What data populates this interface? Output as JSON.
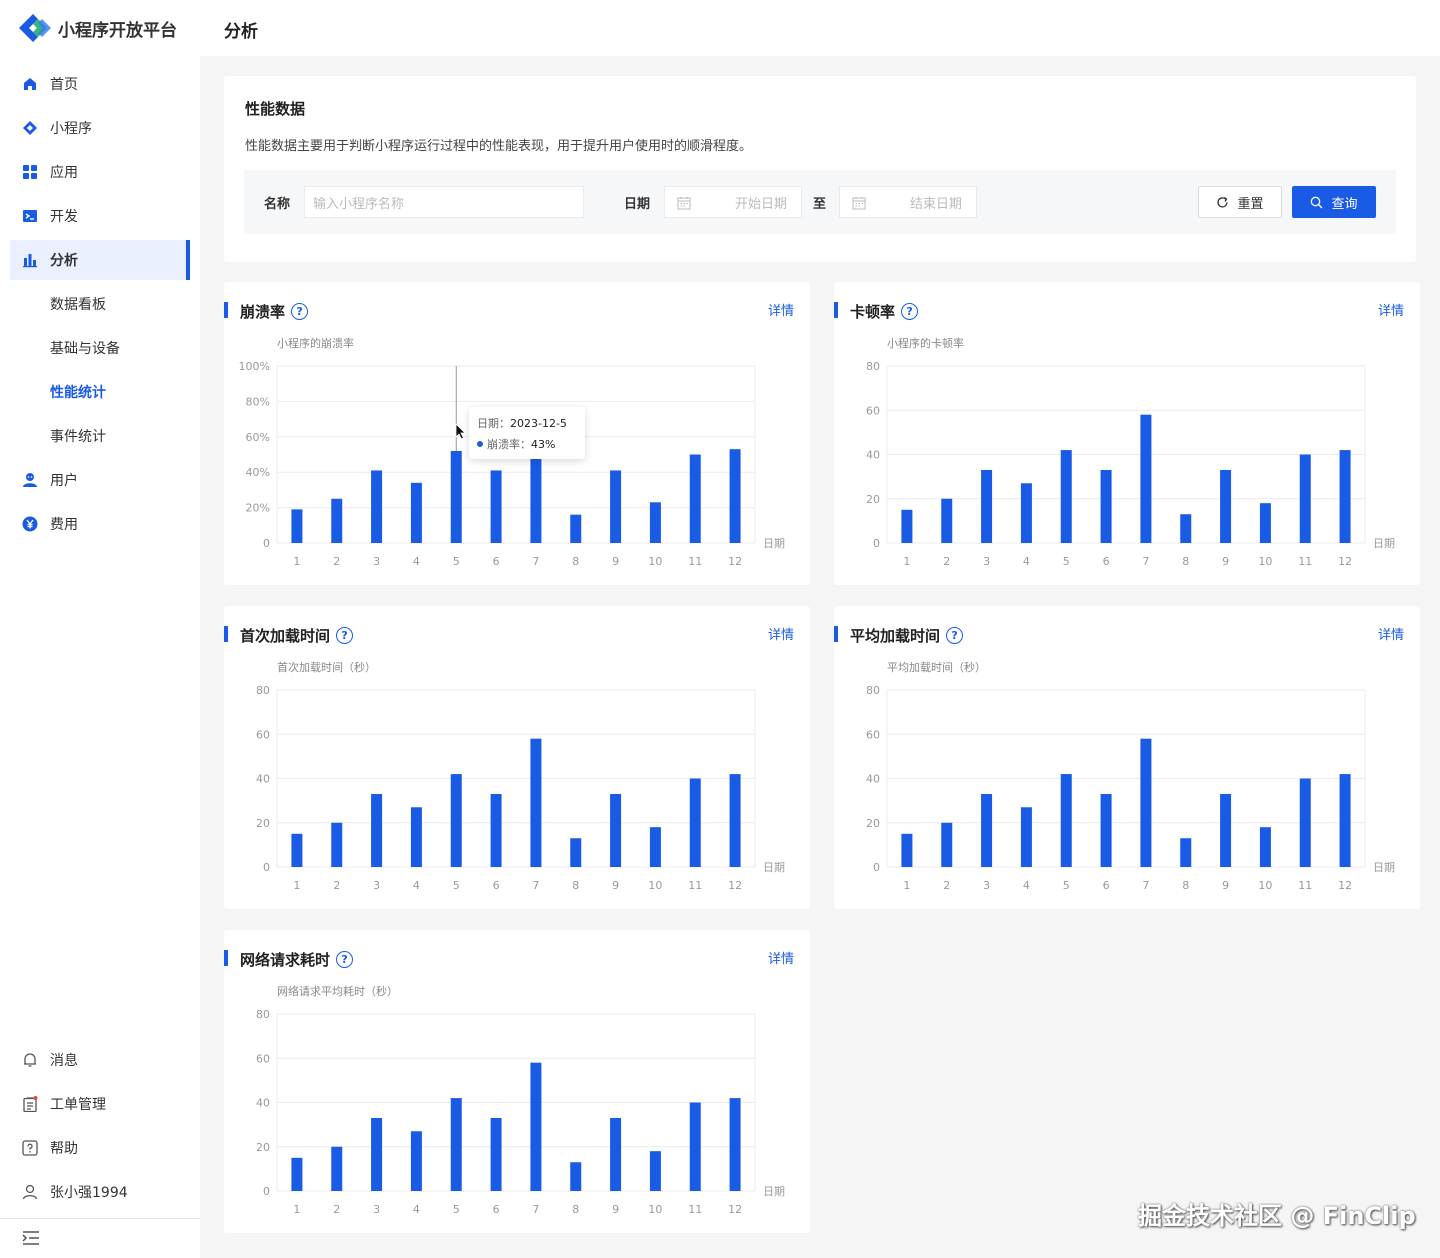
{
  "app": {
    "title": "小程序开放平台"
  },
  "header": {
    "title": "分析"
  },
  "sidebar": {
    "items": [
      {
        "label": "首页",
        "icon": "home-icon"
      },
      {
        "label": "小程序",
        "icon": "diamond-icon"
      },
      {
        "label": "应用",
        "icon": "grid-icon"
      },
      {
        "label": "开发",
        "icon": "terminal-icon"
      },
      {
        "label": "分析",
        "icon": "bar-chart-icon"
      }
    ],
    "sub_items": [
      {
        "label": "数据看板"
      },
      {
        "label": "基础与设备"
      },
      {
        "label": "性能统计"
      },
      {
        "label": "事件统计"
      }
    ],
    "items2": [
      {
        "label": "用户",
        "icon": "user-icon"
      },
      {
        "label": "费用",
        "icon": "yen-icon"
      }
    ],
    "bottom": [
      {
        "label": "消息",
        "icon": "bell-icon"
      },
      {
        "label": "工单管理",
        "icon": "clipboard-icon"
      },
      {
        "label": "帮助",
        "icon": "help-icon"
      },
      {
        "label": "张小强1994",
        "icon": "person-icon"
      }
    ]
  },
  "perf": {
    "title": "性能数据",
    "desc": "性能数据主要用于判断小程序运行过程中的性能表现，用于提升用户使用时的顺滑程度。",
    "name_label": "名称",
    "name_placeholder": "输入小程序名称",
    "date_label": "日期",
    "start_placeholder": "开始日期",
    "to_label": "至",
    "end_placeholder": "结束日期",
    "reset_label": "重置",
    "query_label": "查询"
  },
  "details_label": "详情",
  "tooltip": {
    "date_label": "日期：",
    "date_value": "2023-12-5",
    "series_label": "崩溃率：",
    "series_value": "43%"
  },
  "chart_data": [
    {
      "type": "bar",
      "title": "崩溃率",
      "subtitle": "小程序的崩溃率",
      "xlabel": "日期",
      "categories": [
        "1",
        "2",
        "3",
        "4",
        "5",
        "6",
        "7",
        "8",
        "9",
        "10",
        "11",
        "12"
      ],
      "values": [
        19,
        25,
        41,
        34,
        52,
        41,
        50,
        16,
        41,
        23,
        50,
        53
      ],
      "yticks": [
        "0",
        "20%",
        "40%",
        "60%",
        "80%",
        "100%"
      ],
      "ylim": [
        0,
        100
      ]
    },
    {
      "type": "bar",
      "title": "卡顿率",
      "subtitle": "小程序的卡顿率",
      "xlabel": "日期",
      "categories": [
        "1",
        "2",
        "3",
        "4",
        "5",
        "6",
        "7",
        "8",
        "9",
        "10",
        "11",
        "12"
      ],
      "values": [
        15,
        20,
        33,
        27,
        42,
        33,
        58,
        13,
        33,
        18,
        40,
        42
      ],
      "yticks": [
        "0",
        "20",
        "40",
        "60",
        "80"
      ],
      "ylim": [
        0,
        80
      ]
    },
    {
      "type": "bar",
      "title": "首次加载时间",
      "subtitle": "首次加载时间（秒）",
      "xlabel": "日期",
      "categories": [
        "1",
        "2",
        "3",
        "4",
        "5",
        "6",
        "7",
        "8",
        "9",
        "10",
        "11",
        "12"
      ],
      "values": [
        15,
        20,
        33,
        27,
        42,
        33,
        58,
        13,
        33,
        18,
        40,
        42
      ],
      "yticks": [
        "0",
        "20",
        "40",
        "60",
        "80"
      ],
      "ylim": [
        0,
        80
      ]
    },
    {
      "type": "bar",
      "title": "平均加载时间",
      "subtitle": "平均加载时间（秒）",
      "xlabel": "日期",
      "categories": [
        "1",
        "2",
        "3",
        "4",
        "5",
        "6",
        "7",
        "8",
        "9",
        "10",
        "11",
        "12"
      ],
      "values": [
        15,
        20,
        33,
        27,
        42,
        33,
        58,
        13,
        33,
        18,
        40,
        42
      ],
      "yticks": [
        "0",
        "20",
        "40",
        "60",
        "80"
      ],
      "ylim": [
        0,
        80
      ]
    },
    {
      "type": "bar",
      "title": "网络请求耗时",
      "subtitle": "网络请求平均耗时（秒）",
      "xlabel": "日期",
      "categories": [
        "1",
        "2",
        "3",
        "4",
        "5",
        "6",
        "7",
        "8",
        "9",
        "10",
        "11",
        "12"
      ],
      "values": [
        15,
        20,
        33,
        27,
        42,
        33,
        58,
        13,
        33,
        18,
        40,
        42
      ],
      "yticks": [
        "0",
        "20",
        "40",
        "60",
        "80"
      ],
      "ylim": [
        0,
        80
      ]
    }
  ],
  "watermark": "掘金技术社区 @ FinClip",
  "colors": {
    "accent": "#1a5be6",
    "active_bg": "#eaf0ff"
  }
}
